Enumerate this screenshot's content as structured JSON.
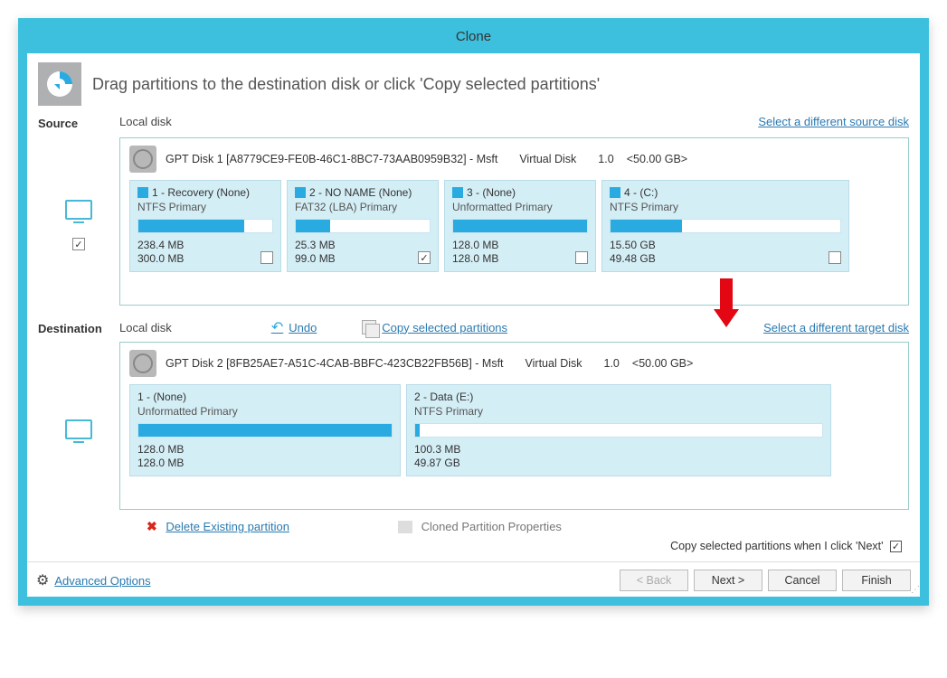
{
  "title": "Clone",
  "instruction": "Drag partitions to the destination disk or click 'Copy selected partitions'",
  "source": {
    "section": "Source",
    "sub": "Local disk",
    "change_link": "Select a different source disk",
    "disk_label": "GPT Disk 1 [A8779CE9-FE0B-46C1-8BC7-73AAB0959B32] - Msft",
    "disk_type": "Virtual Disk",
    "disk_ver": "1.0",
    "disk_size": "<50.00 GB>",
    "checked": "✓",
    "partitions": [
      {
        "idx": "1",
        "name": "Recovery (None)",
        "fs": "NTFS Primary",
        "used": "238.4 MB",
        "total": "300.0 MB",
        "fill": 79,
        "win": true,
        "checked": false
      },
      {
        "idx": "2",
        "name": "NO NAME (None)",
        "fs": "FAT32 (LBA) Primary",
        "used": "25.3 MB",
        "total": "99.0 MB",
        "fill": 26,
        "win": true,
        "checked": true
      },
      {
        "idx": "3",
        "name": " (None)",
        "fs": "Unformatted Primary",
        "used": "128.0 MB",
        "total": "128.0 MB",
        "fill": 100,
        "win": true,
        "checked": false
      },
      {
        "idx": "4",
        "name": " (C:)",
        "fs": "NTFS Primary",
        "used": "15.50 GB",
        "total": "49.48 GB",
        "fill": 31,
        "win": true,
        "checked": false
      }
    ]
  },
  "dest": {
    "section": "Destination",
    "sub": "Local disk",
    "undo": "Undo",
    "copy_sel": "Copy selected partitions",
    "change_link": "Select a different target disk",
    "disk_label": "GPT Disk 2 [8FB25AE7-A51C-4CAB-BBFC-423CB22FB56B] - Msft",
    "disk_type": "Virtual Disk",
    "disk_ver": "1.0",
    "disk_size": "<50.00 GB>",
    "partitions": [
      {
        "idx": "1",
        "name": " (None)",
        "fs": "Unformatted Primary",
        "used": "128.0 MB",
        "total": "128.0 MB",
        "fill": 100
      },
      {
        "idx": "2",
        "name": "Data (E:)",
        "fs": "NTFS Primary",
        "used": "100.3 MB",
        "total": "49.87 GB",
        "fill": 1
      }
    ]
  },
  "actions": {
    "delete": "Delete Existing partition",
    "props": "Cloned Partition Properties",
    "copy_next": "Copy selected partitions when I click 'Next'",
    "advanced": "Advanced Options"
  },
  "buttons": {
    "back": "< Back",
    "next": "Next >",
    "cancel": "Cancel",
    "finish": "Finish"
  }
}
